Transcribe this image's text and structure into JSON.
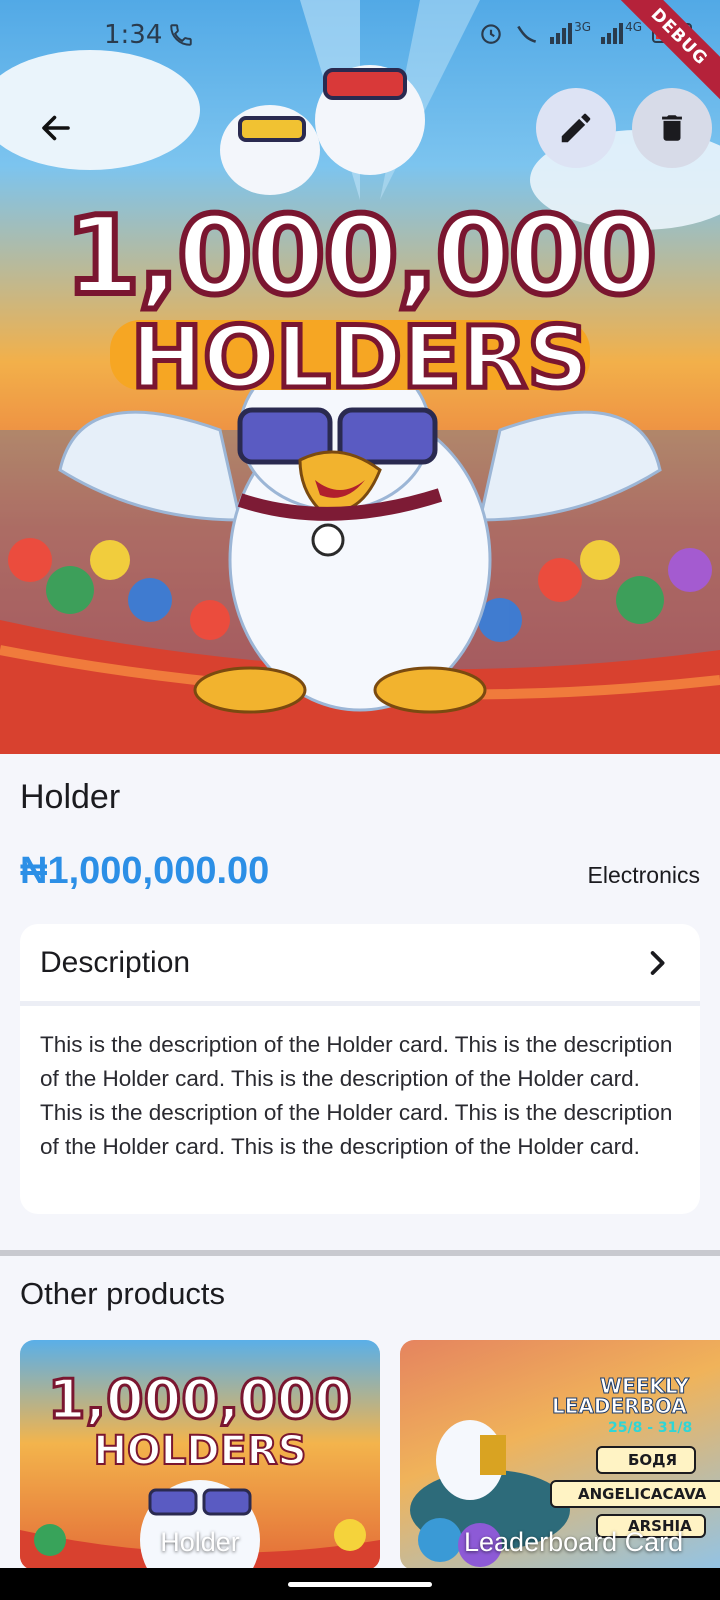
{
  "status_bar": {
    "time": "1:34",
    "network_a": "3G",
    "network_b": "4G",
    "debug_label": "DEBUG"
  },
  "hero": {
    "headline_number": "1,000,000",
    "headline_word": "HOLDERS"
  },
  "actions": {
    "back_icon": "arrow-left-icon",
    "edit_icon": "pencil-icon",
    "delete_icon": "trash-icon"
  },
  "product": {
    "name": "Holder",
    "price": "₦1,000,000.00",
    "category": "Electronics"
  },
  "description": {
    "title": "Description",
    "text": "This is the description of the Holder card. This is the description of the Holder card. This is the description of the Holder card. This is the description of the Holder card. This is the description of the Holder card. This is the description of the Holder card."
  },
  "other_products": {
    "title": "Other products",
    "items": [
      {
        "label": "Holder",
        "art_line1": "1,000,000",
        "art_line2": "HOLDERS"
      },
      {
        "label": "Leaderboard Card",
        "art_line1": "WEEKLY",
        "art_line2": "LEADERBOA",
        "art_dates": "25/8 - 31/8",
        "art_rank1": "БОДЯ",
        "art_rank2": "ANGELICACAVA",
        "art_rank3": "ARSHIA"
      }
    ]
  },
  "colors": {
    "price": "#2c8fe6",
    "background": "#f5f6fb",
    "edit_bg": "#dde3f4",
    "delete_bg": "#d7dbe8"
  }
}
